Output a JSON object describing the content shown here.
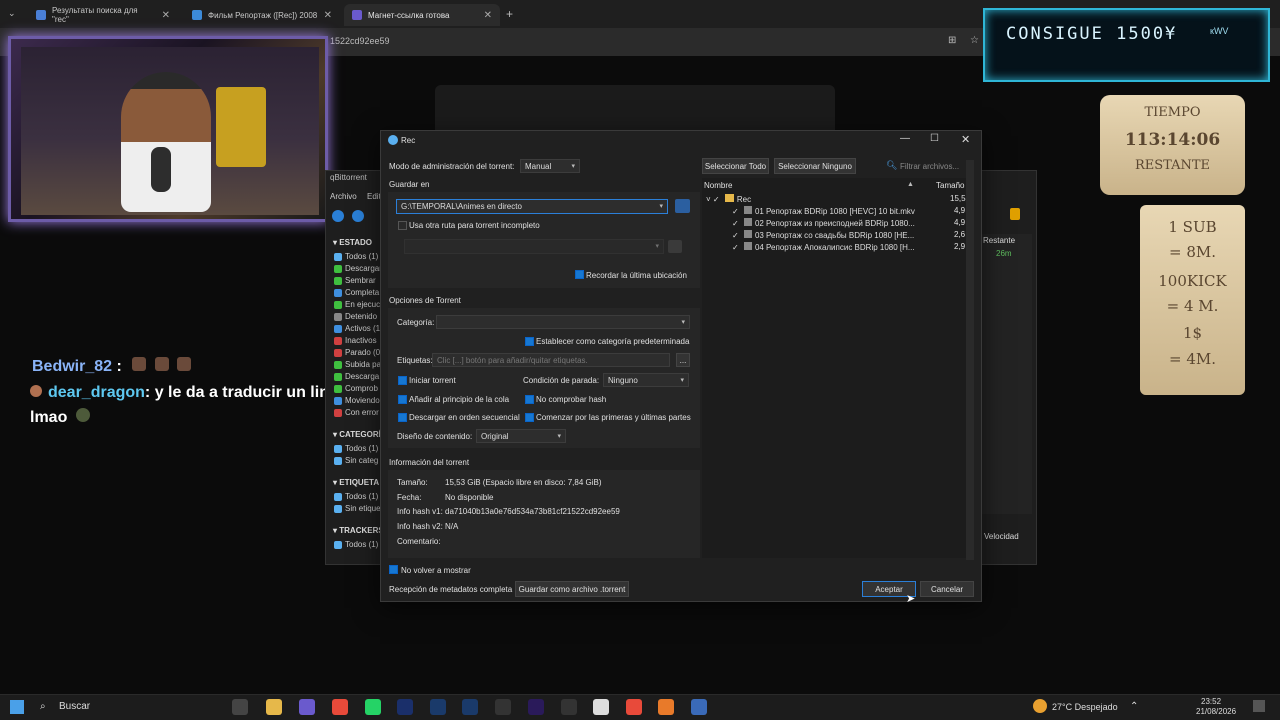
{
  "browser": {
    "tabs": [
      {
        "title": "Результаты поиска для \"rec\"",
        "color": "#4a7fd6"
      },
      {
        "title": "Фильм Репортаж ([Rec]) 2008",
        "color": "#3c8ad8"
      },
      {
        "title": "Магнет-ссылка готова",
        "color": "#6a5acd"
      }
    ],
    "url": "1522cd92ee59"
  },
  "stream": {
    "goal": "CONSIGUE 1500¥",
    "goal_tag": "кWV",
    "timer_label_top": "TIEMPO",
    "timer_value": "113:14:06",
    "timer_label_bottom": "RESTANTE",
    "rewards": [
      "1 SUB",
      "= 8M.",
      "100KICK",
      "= 4 M.",
      "1$",
      "= 4M."
    ],
    "chat": [
      {
        "user": "Bedwir_82",
        "user_color": "#8ab4f8",
        "text": ":"
      },
      {
        "user": "dear_dragon",
        "user_color": "#5ec8f0",
        "text": ": y le da a traducir un link"
      },
      {
        "user": "",
        "user_color": "#ffffff",
        "text": "lmao"
      }
    ]
  },
  "qbittorrent": {
    "title": "qBittorrent",
    "menu": [
      "Archivo",
      "Edit"
    ],
    "sections": {
      "estado": "ESTADO",
      "estado_items": [
        "Todos (1)",
        "Descargar",
        "Sembrar",
        "Completa",
        "En ejecuc",
        "Detenido",
        "Activos (1",
        "Inactivos",
        "Parado (0",
        "Subida pa",
        "Descarga",
        "Comprob",
        "Moviendo",
        "Con error"
      ],
      "categorias": "CATEGORÍ",
      "categorias_items": [
        "Todos (1)",
        "Sin categ"
      ],
      "etiquetas": "ETIQUETA",
      "etiquetas_items": [
        "Todos (1)",
        "Sin etique"
      ],
      "trackers": "TRACKERS",
      "trackers_items": [
        "Todos (1)"
      ]
    },
    "right_column": {
      "header": "Restante",
      "value": "26m",
      "speed": "Velocidad"
    }
  },
  "dialog": {
    "title": "Rec",
    "modo_label": "Modo de administración del torrent:",
    "modo_value": "Manual",
    "guardar_label": "Guardar en",
    "guardar_value": "G:\\TEMPORAL\\Animes en directo",
    "otra_ruta": "Usa otra ruta para torrent incompleto",
    "recordar": "Recordar la última ubicación",
    "opciones": "Opciones de Torrent",
    "categoria_label": "Categoría:",
    "establecer": "Establecer como categoría predeterminada",
    "etiquetas_label": "Etiquetas:",
    "etiquetas_placeholder": "Clic [...] botón para añadir/quitar etiquetas.",
    "etiquetas_btn": "...",
    "iniciar": "Iniciar torrent",
    "condicion_label": "Condición de parada:",
    "condicion_value": "Ninguno",
    "anadir_cola": "Añadir al principio de la cola",
    "no_comprobar": "No comprobar hash",
    "secuencial": "Descargar en orden secuencial",
    "primeras": "Comenzar por las primeras y últimas partes",
    "diseno_label": "Diseño de contenido:",
    "diseno_value": "Original",
    "info_header": "Información del torrent",
    "info": [
      {
        "k": "Tamaño:",
        "v": "15,53 GiB (Espacio libre en disco: 7,84 GiB)"
      },
      {
        "k": "Fecha:",
        "v": "No disponible"
      },
      {
        "k": "Info hash v1:",
        "v": "da71040b13a0e76d534a73b81cf21522cd92ee59"
      },
      {
        "k": "Info hash v2:",
        "v": "N/A"
      },
      {
        "k": "Comentario:",
        "v": ""
      }
    ],
    "no_volver": "No volver a mostrar",
    "metadatos": "Recepción de metadatos completa",
    "guardar_torrent": "Guardar como archivo .torrent",
    "aceptar": "Aceptar",
    "cancelar": "Cancelar",
    "sel_todo": "Seleccionar Todo",
    "sel_ninguno": "Seleccionar Ninguno",
    "filtro_placeholder": "Filtrar archivos...",
    "col_nombre": "Nombre",
    "col_tamano": "Tamaño",
    "root": {
      "name": "Rec",
      "size": "15,5"
    },
    "files": [
      {
        "name": "01 Репортаж BDRip 1080 [HEVC] 10 bit.mkv",
        "size": "4,9"
      },
      {
        "name": "02 Репортаж из преисподней BDRip 1080...",
        "size": "4,9"
      },
      {
        "name": "03 Репортаж со свадьбы BDRip 1080 [HE...",
        "size": "2,6"
      },
      {
        "name": "04 Репортаж Апокалипсис BDRip 1080 [H...",
        "size": "2,9"
      }
    ]
  },
  "taskbar": {
    "search": "Buscar",
    "weather": "27°C Despejado",
    "time": "23:52",
    "date": "21/08/2026"
  }
}
